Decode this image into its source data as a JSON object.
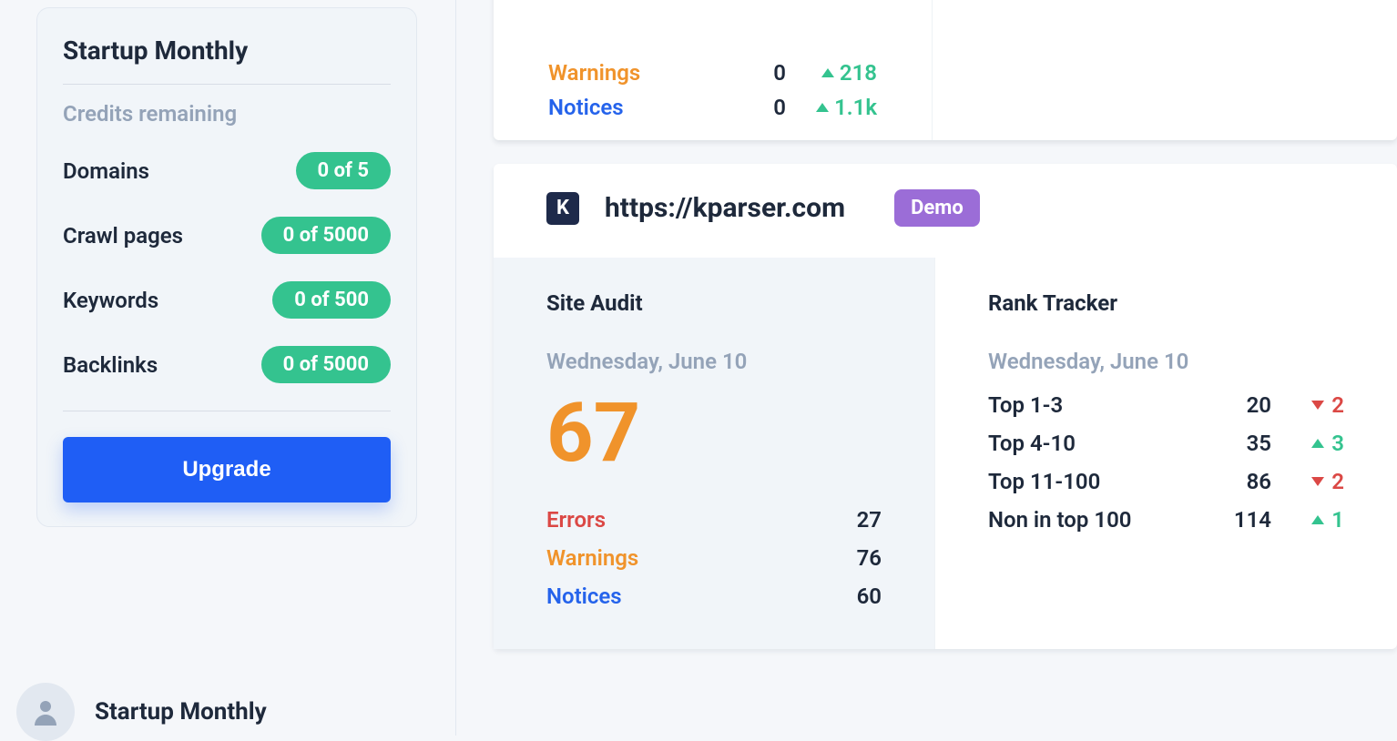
{
  "sidebar": {
    "plan_title": "Startup Monthly",
    "credits_label": "Credits remaining",
    "credits": [
      {
        "label": "Domains",
        "value": "0 of 5"
      },
      {
        "label": "Crawl pages",
        "value": "0 of 5000"
      },
      {
        "label": "Keywords",
        "value": "0 of 500"
      },
      {
        "label": "Backlinks",
        "value": "0 of 5000"
      }
    ],
    "upgrade_label": "Upgrade"
  },
  "user": {
    "name": "Startup Monthly"
  },
  "top_card": {
    "issues": [
      {
        "label": "Warnings",
        "color": "c-warn",
        "count": "0",
        "delta": "218"
      },
      {
        "label": "Notices",
        "color": "c-notice",
        "count": "0",
        "delta": "1.1k"
      }
    ]
  },
  "project": {
    "favicon_letter": "K",
    "url": "https://kparser.com",
    "badge": "Demo",
    "audit": {
      "title": "Site Audit",
      "date": "Wednesday, June 10",
      "score": "67",
      "rows": [
        {
          "label": "Errors",
          "color": "c-error",
          "value": "27"
        },
        {
          "label": "Warnings",
          "color": "c-warn",
          "value": "76"
        },
        {
          "label": "Notices",
          "color": "c-notice",
          "value": "60"
        }
      ]
    },
    "rank": {
      "title": "Rank Tracker",
      "date": "Wednesday, June 10",
      "rows": [
        {
          "label": "Top 1-3",
          "value": "20",
          "trend": "down",
          "delta": "2"
        },
        {
          "label": "Top 4-10",
          "value": "35",
          "trend": "up",
          "delta": "3"
        },
        {
          "label": "Top 11-100",
          "value": "86",
          "trend": "down",
          "delta": "2"
        },
        {
          "label": "Non in top 100",
          "value": "114",
          "trend": "up",
          "delta": "1"
        }
      ]
    }
  }
}
